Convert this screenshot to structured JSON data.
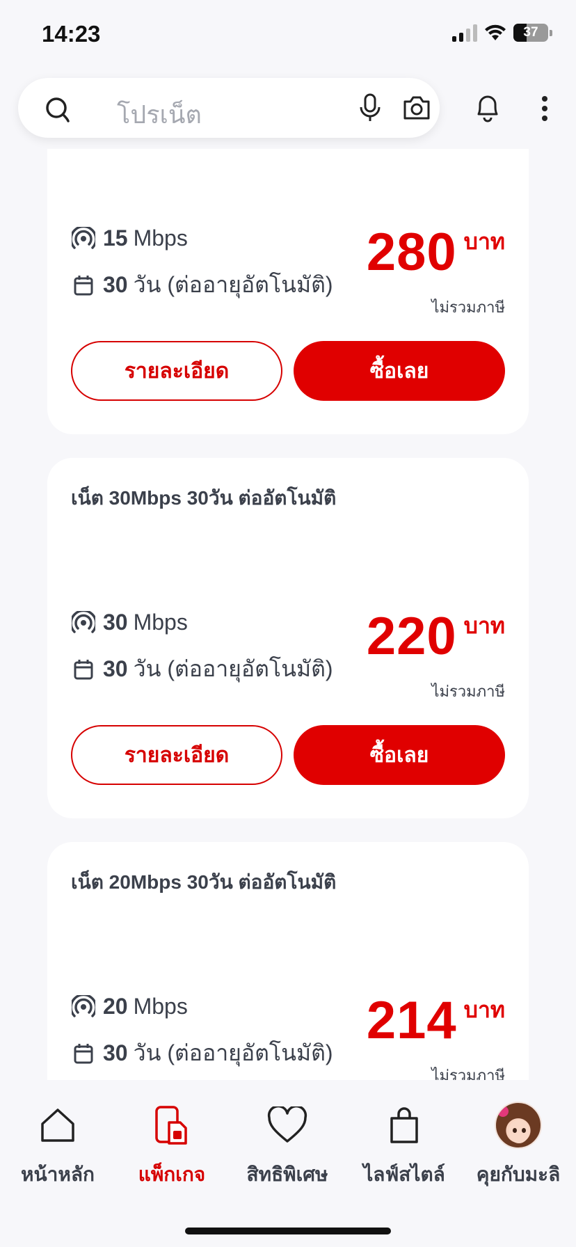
{
  "status_bar": {
    "time": "14:23",
    "battery": "37",
    "battery_level_percent": 37
  },
  "search": {
    "placeholder": "โปรเน็ต",
    "icons": [
      "search-icon",
      "mic-icon",
      "camera-icon"
    ]
  },
  "header_actions": [
    "bell-icon",
    "more-vert-icon"
  ],
  "packages": [
    {
      "title": "",
      "speed_value": "15",
      "speed_unit": "Mbps",
      "days_value": "30",
      "days_text": "วัน (ต่ออายุอัตโนมัติ)",
      "price": "280",
      "currency": "บาท",
      "vat_note": "ไม่รวมภาษี",
      "details_label": "รายละเอียด",
      "buy_label": "ซื้อเลย"
    },
    {
      "title": "เน็ต 30Mbps 30วัน ต่ออัตโนมัติ",
      "speed_value": "30",
      "speed_unit": "Mbps",
      "days_value": "30",
      "days_text": "วัน (ต่ออายุอัตโนมัติ)",
      "price": "220",
      "currency": "บาท",
      "vat_note": "ไม่รวมภาษี",
      "details_label": "รายละเอียด",
      "buy_label": "ซื้อเลย"
    },
    {
      "title": "เน็ต 20Mbps 30วัน ต่ออัตโนมัติ",
      "speed_value": "20",
      "speed_unit": "Mbps",
      "days_value": "30",
      "days_text": "วัน (ต่ออายุอัตโนมัติ)",
      "price": "214",
      "currency": "บาท",
      "vat_note": "ไม่รวมภาษี"
    }
  ],
  "bottom_nav": [
    {
      "label": "หน้าหลัก",
      "icon": "home-icon",
      "active": false
    },
    {
      "label": "แพ็กเกจ",
      "icon": "package-sim-icon",
      "active": true
    },
    {
      "label": "สิทธิพิเศษ",
      "icon": "heart-icon",
      "active": false
    },
    {
      "label": "ไลฟ์สไตล์",
      "icon": "shopping-bag-icon",
      "active": false
    },
    {
      "label": "คุยกับมะลิ",
      "icon": "assistant-avatar",
      "active": false
    }
  ],
  "colors": {
    "accent": "#e00000",
    "text": "#3b404b",
    "background": "#f7f7fa",
    "card": "#ffffff"
  }
}
